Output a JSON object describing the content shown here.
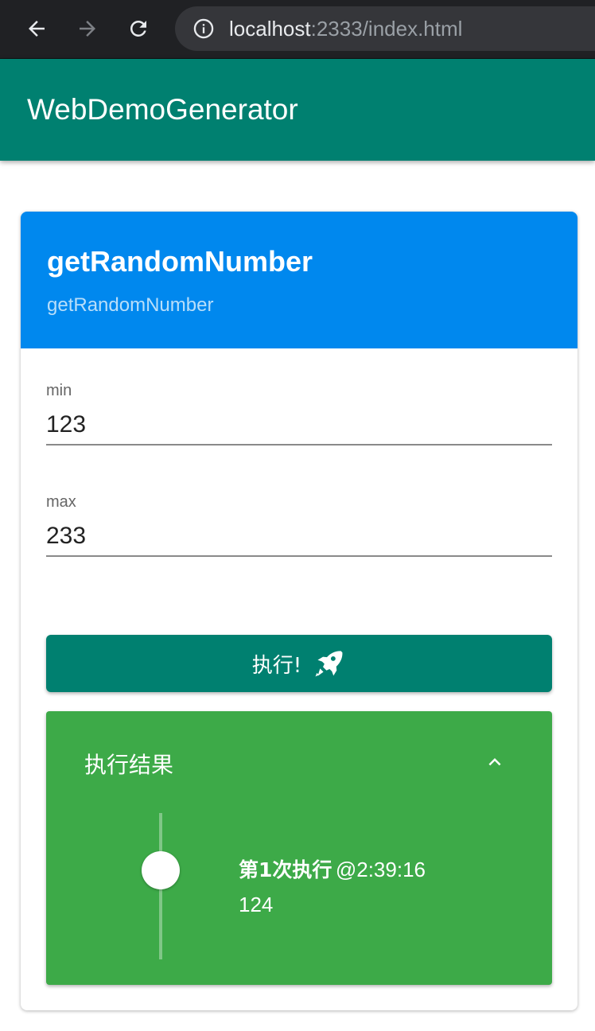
{
  "browser": {
    "url_host": "localhost",
    "url_rest": ":2333/index.html"
  },
  "appbar": {
    "title": "WebDemoGenerator"
  },
  "card": {
    "title": "getRandomNumber",
    "subtitle": "getRandomNumber",
    "fields": [
      {
        "label": "min",
        "value": "123"
      },
      {
        "label": "max",
        "value": "233"
      }
    ],
    "run_label": "执行!",
    "result": {
      "title": "执行结果",
      "entries": [
        {
          "run": "第1次执行",
          "time": "@2:39:16",
          "value": "124"
        }
      ]
    }
  },
  "colors": {
    "appbar": "#008070",
    "card_header": "#0088ee",
    "run_button": "#008070",
    "result_panel": "#3daa48"
  }
}
